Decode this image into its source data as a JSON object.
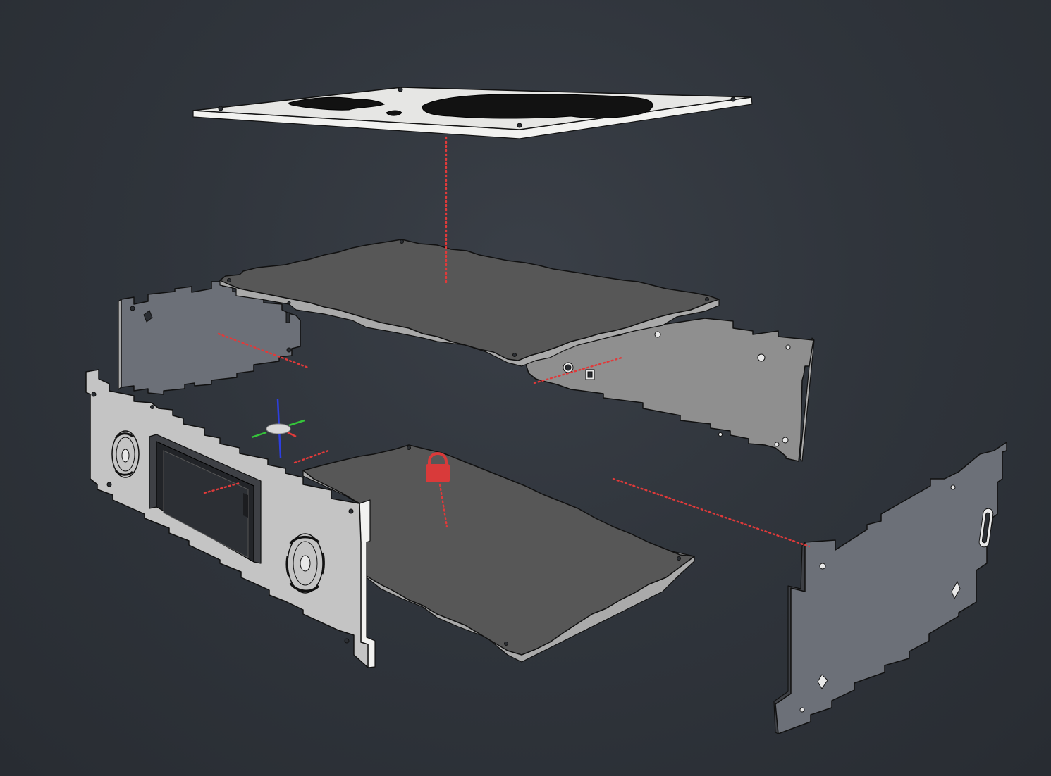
{
  "viewport": {
    "background_color": "#2f343b"
  },
  "scene": {
    "parts": [
      {
        "id": "top-lid",
        "icon": "plate"
      },
      {
        "id": "upper-deck-plate",
        "icon": "plate"
      },
      {
        "id": "rear-left-wall",
        "icon": "plate"
      },
      {
        "id": "rear-right-wall",
        "icon": "plate"
      },
      {
        "id": "front-panel-with-display",
        "icon": "plate"
      },
      {
        "id": "base-plate",
        "icon": "plate"
      },
      {
        "id": "right-side-wall",
        "icon": "plate"
      }
    ],
    "constraint_color": "#e03a3a",
    "lock_color": "#d93a3a"
  },
  "gizmo": {
    "axes": [
      {
        "name": "x",
        "color": "#e23b3b"
      },
      {
        "name": "y",
        "color": "#35c43a"
      },
      {
        "name": "z",
        "color": "#2d3fe0"
      }
    ],
    "center_color": "#d8d8d8"
  },
  "lock": {
    "icon": "lock-icon",
    "color": "#d93a3a"
  }
}
